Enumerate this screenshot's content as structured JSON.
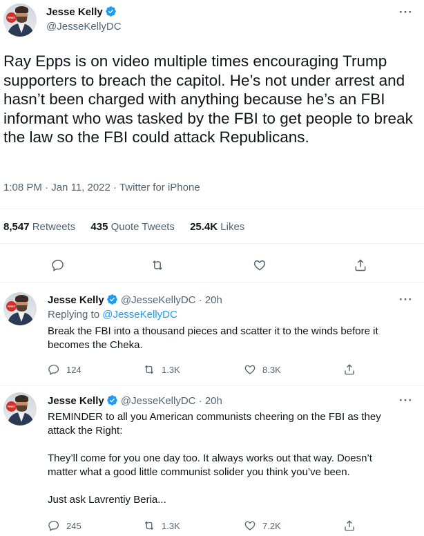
{
  "main_tweet": {
    "author_name": "Jesse Kelly",
    "author_handle": "@JesseKellyDC",
    "text": "Ray Epps is on video multiple times encouraging Trump supporters to breach the capitol. He’s not under arrest and hasn’t been charged with anything because he’s an FBI informant who was tasked by the FBI to get people to break the law so the FBI could attack Republicans.",
    "time": "1:08 PM",
    "date": "Jan 11, 2022",
    "source": "Twitter for iPhone",
    "retweets_count": "8,547",
    "retweets_label": "Retweets",
    "quotes_count": "435",
    "quotes_label": "Quote Tweets",
    "likes_count": "25.4K",
    "likes_label": "Likes"
  },
  "replies": [
    {
      "author_name": "Jesse Kelly",
      "author_handle": "@JesseKellyDC",
      "age": "20h",
      "replying_prefix": "Replying to",
      "replying_to": "@JesseKellyDC",
      "text_lines": [
        "Break the FBI into a thousand pieces and scatter it to the winds before it",
        "becomes the Cheka."
      ],
      "reply_count": "124",
      "retweet_count": "1.3K",
      "like_count": "8.3K"
    },
    {
      "author_name": "Jesse Kelly",
      "author_handle": "@JesseKellyDC",
      "age": "20h",
      "text_lines": [
        "REMINDER to all you American communists cheering on the FBI as they",
        "attack the Right:",
        "They’ll come for you one day too. It always works out that way. Doesn’t",
        "matter what a good little communist solider you think you’ve been.",
        "Just ask Lavrentiy Beria..."
      ],
      "reply_count": "245",
      "retweet_count": "1.3K",
      "like_count": "7.2K"
    }
  ],
  "ui": {
    "more_glyph": "···",
    "separator": "·",
    "avatar_badge_text": "FIRST",
    "accent_color": "#1d9bf0",
    "icons": [
      "verified-badge-icon",
      "more-icon",
      "reply-icon",
      "retweet-icon",
      "like-icon",
      "share-icon"
    ]
  }
}
